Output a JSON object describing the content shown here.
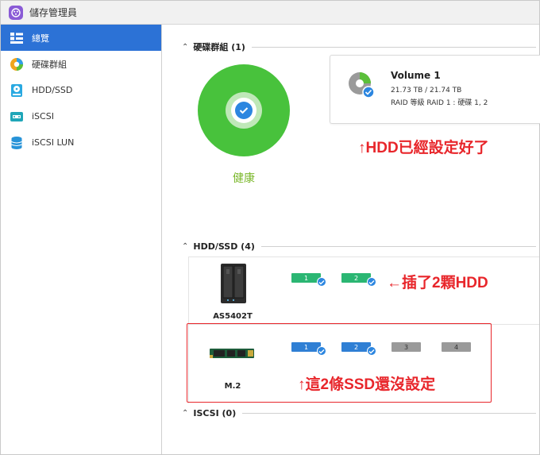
{
  "window": {
    "title": "儲存管理員"
  },
  "sidebar": {
    "items": [
      {
        "label": "總覽",
        "icon": "overview-icon",
        "active": true
      },
      {
        "label": "硬碟群組",
        "icon": "disk-group-icon",
        "active": false
      },
      {
        "label": "HDD/SSD",
        "icon": "hdd-ssd-icon",
        "active": false
      },
      {
        "label": "iSCSI",
        "icon": "iscsi-icon",
        "active": false
      },
      {
        "label": "iSCSI LUN",
        "icon": "iscsi-lun-icon",
        "active": false
      }
    ]
  },
  "volumes_section": {
    "title": "硬碟群組 (1)",
    "health_label": "健康",
    "volume": {
      "name": "Volume 1",
      "capacity": "21.73 TB / 21.74 TB",
      "raid": "RAID 等級 RAID 1 : 硬碟 1, 2"
    },
    "annotation": "↑HDD已經設定好了"
  },
  "hdd_section": {
    "title": "HDD/SSD (4)",
    "devices": [
      {
        "label": "AS5402T",
        "slots": [
          {
            "number": "1",
            "status": "ok"
          },
          {
            "number": "2",
            "status": "ok"
          }
        ]
      },
      {
        "label": "M.2",
        "slots": [
          {
            "number": "1",
            "status": "ok"
          },
          {
            "number": "2",
            "status": "ok"
          },
          {
            "number": "3",
            "status": "empty"
          },
          {
            "number": "4",
            "status": "empty"
          }
        ]
      }
    ],
    "annotation_hdd": "←插了2顆HDD",
    "annotation_ssd": "↑這2條SSD還沒設定"
  },
  "iscsi_section": {
    "title": "ISCSI (0)"
  },
  "colors": {
    "accent": "#2c72d6",
    "health": "#48c23c",
    "annotation": "#e8262b",
    "slot_hdd": "#2bb673",
    "slot_ssd": "#2f7fd4",
    "slot_empty": "#9a9a9a"
  }
}
